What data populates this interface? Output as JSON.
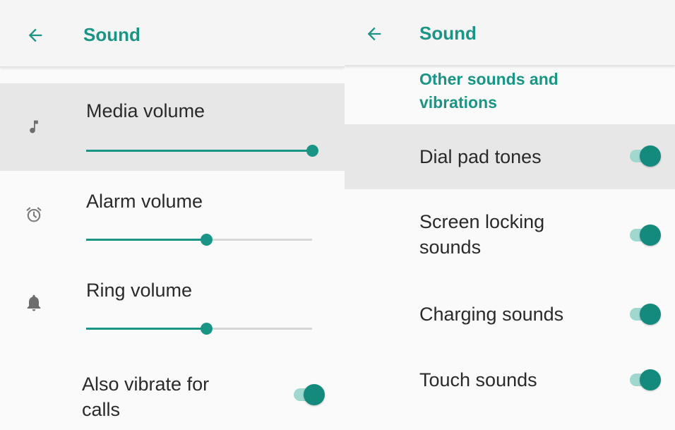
{
  "left": {
    "app_bar": {
      "title": "Sound"
    },
    "volumes": [
      {
        "label": "Media volume",
        "icon": "music-note-icon",
        "level": 1.0
      },
      {
        "label": "Alarm volume",
        "icon": "alarm-clock-icon",
        "level": 0.53
      },
      {
        "label": "Ring volume",
        "icon": "bell-icon",
        "level": 0.53
      }
    ],
    "vibrate_toggle": {
      "label_line1": "Also vibrate for",
      "label_line2": "calls",
      "on": true
    }
  },
  "right": {
    "app_bar": {
      "title": "Sound"
    },
    "section": {
      "line1": "Other sounds and",
      "line2": "vibrations"
    },
    "toggles": [
      {
        "label": "Dial pad tones",
        "on": true
      },
      {
        "label_line1": "Screen locking",
        "label_line2": "sounds",
        "on": true
      },
      {
        "label": "Charging sounds",
        "on": true
      },
      {
        "label": "Touch sounds",
        "on": true
      }
    ]
  },
  "colors": {
    "accent": "#1a9585",
    "toggle_track": "#a0d7cf",
    "toggle_thumb": "#138a7c",
    "highlight_row": "#e7e7e7",
    "slider_track": "#d6d6d6"
  }
}
